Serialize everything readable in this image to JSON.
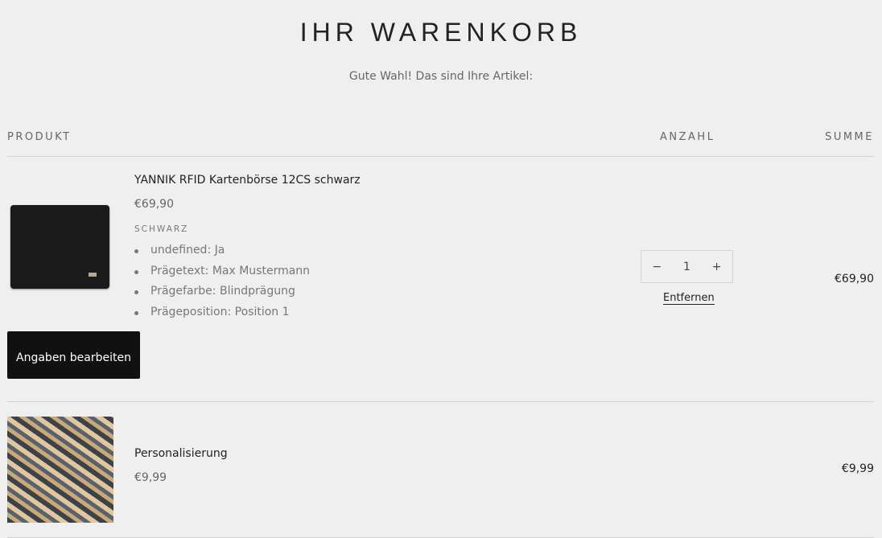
{
  "page": {
    "title": "IHR WARENKORB",
    "subtitle": "Gute Wahl! Das sind Ihre Artikel:"
  },
  "columns": {
    "product": "PRODUKT",
    "quantity": "ANZAHL",
    "total": "SUMME"
  },
  "items": [
    {
      "name": "YANNIK RFID Kartenbörse 12CS schwarz",
      "price": "€69,90",
      "variant": "SCHWARZ",
      "properties": [
        "undefined: Ja",
        "Prägetext: Max Mustermann",
        "Prägefarbe: Blindprägung",
        "Prägeposition: Position 1"
      ],
      "edit_label": "Angaben bearbeiten",
      "quantity": "1",
      "minus": "−",
      "plus": "+",
      "remove_label": "Entfernen",
      "total": "€69,90"
    },
    {
      "name": "Personalisierung",
      "price": "€9,99",
      "total": "€9,99"
    }
  ]
}
